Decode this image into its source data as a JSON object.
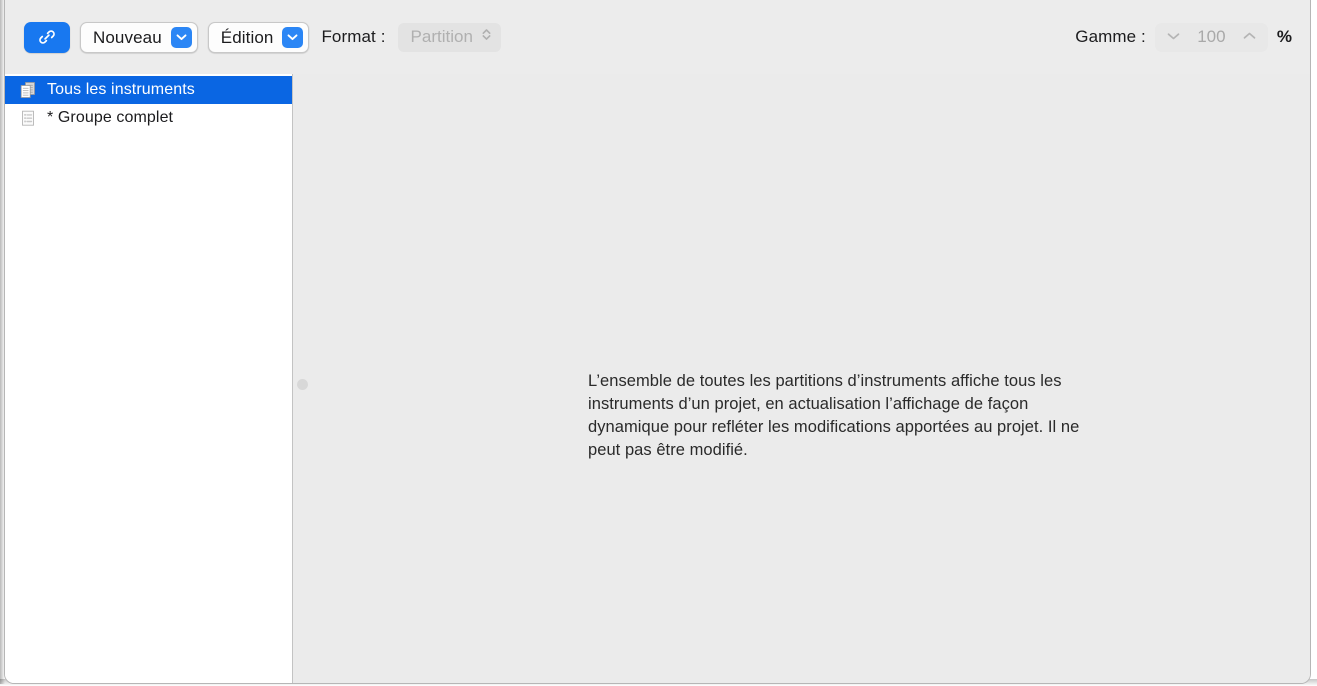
{
  "window": {
    "accent_blue": "#1878f0",
    "selection_blue": "#0a66e3",
    "toolbar_bg": "#ececec",
    "content_bg": "#ebebeb",
    "sidebar_bg": "#ffffff"
  },
  "toolbar": {
    "link_button": {
      "icon": "link-chain-icon"
    },
    "new_button": {
      "label": "Nouveau",
      "icon": "chevron-down-icon"
    },
    "edit_button": {
      "label": "Édition",
      "icon": "chevron-down-icon"
    },
    "format_label": "Format :",
    "format_popup": {
      "value": "Partition",
      "icon": "chevron-up-down-icon",
      "enabled": false
    },
    "scale_label": "Gamme :",
    "scale_stepper": {
      "value": "100",
      "decrement_icon": "chevron-down-icon",
      "increment_icon": "chevron-up-icon",
      "enabled": false
    },
    "percent_label": "%"
  },
  "sidebar": {
    "items": [
      {
        "label": "Tous les instruments",
        "icon": "multi-score-pages-icon",
        "selected": true
      },
      {
        "label": "* Groupe complet",
        "icon": "single-score-page-icon",
        "selected": false
      }
    ]
  },
  "content": {
    "description": "L’ensemble de toutes les partitions d’instruments affiche tous les instruments d’un projet, en actualisation l’affichage de façon dynamique pour refléter les modifications apportées au projet. Il ne peut pas être modifié.",
    "split_handle": "pane-resize-handle"
  }
}
